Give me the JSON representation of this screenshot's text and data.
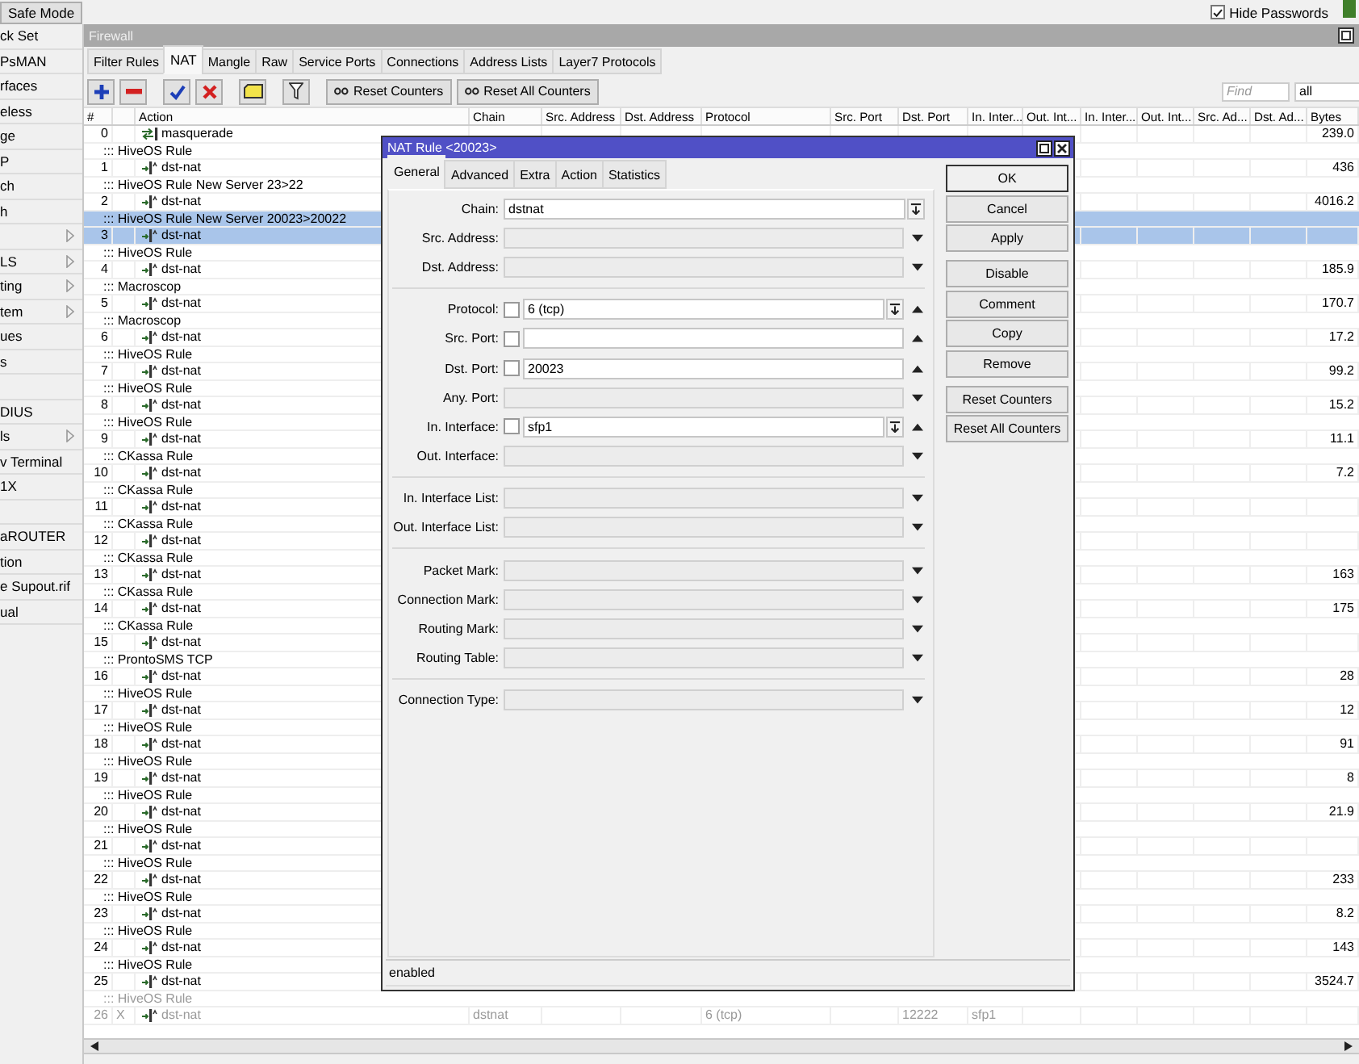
{
  "top_bar": {
    "safe_mode": "Safe Mode",
    "hide_passwords": {
      "label": "Hide Passwords",
      "checked": true
    }
  },
  "sidebar": {
    "items": [
      {
        "label": "ck Set",
        "submenu": false
      },
      {
        "label": "PsMAN",
        "submenu": false
      },
      {
        "label": "rfaces",
        "submenu": false
      },
      {
        "label": "eless",
        "submenu": false
      },
      {
        "label": "ge",
        "submenu": false
      },
      {
        "label": "P",
        "submenu": false
      },
      {
        "label": "ch",
        "submenu": false
      },
      {
        "label": "h",
        "submenu": false
      },
      {
        "submenu": true
      },
      {
        "label": "LS",
        "submenu": true
      },
      {
        "label": "ting",
        "submenu": true
      },
      {
        "label": "tem",
        "submenu": true
      },
      {
        "label": "ues",
        "submenu": false
      },
      {
        "label": "s",
        "submenu": false
      },
      {
        "submenu": false
      },
      {
        "label": "DIUS",
        "submenu": false
      },
      {
        "label": "ls",
        "submenu": true
      },
      {
        "label": "v Terminal",
        "submenu": false
      },
      {
        "label": "1X",
        "submenu": false
      },
      {
        "submenu": false
      },
      {
        "label": "aROUTER",
        "submenu": false
      },
      {
        "label": "tion",
        "submenu": false
      },
      {
        "label": "e Supout.rif",
        "submenu": false
      },
      {
        "label": "ual",
        "submenu": false
      }
    ]
  },
  "firewall": {
    "title": "Firewall",
    "tabs": [
      {
        "label": "Filter Rules",
        "selected": false
      },
      {
        "label": "NAT",
        "selected": true
      },
      {
        "label": "Mangle",
        "selected": false
      },
      {
        "label": "Raw",
        "selected": false
      },
      {
        "label": "Service Ports",
        "selected": false
      },
      {
        "label": "Connections",
        "selected": false
      },
      {
        "label": "Address Lists",
        "selected": false
      },
      {
        "label": "Layer7 Protocols",
        "selected": false
      }
    ],
    "toolbar": {
      "icons": [
        {
          "kind": "add"
        },
        {
          "kind": "remove"
        },
        {
          "kind": "enable"
        },
        {
          "kind": "disable"
        },
        {
          "kind": "comment"
        },
        {
          "kind": "filter"
        }
      ],
      "buttons": [
        "Reset Counters",
        "Reset All Counters"
      ],
      "find_placeholder": "Find",
      "filter_value": "all"
    },
    "table": {
      "columns": [
        "#",
        "Action",
        "Chain",
        "Src. Address",
        "Dst. Address",
        "Protocol",
        "Src. Port",
        "Dst. Port",
        "In. Inter...",
        "Out. Int...",
        "In. Inter...",
        "Out. Int...",
        "Src. Ad...",
        "Dst. Ad...",
        "Bytes"
      ],
      "rows": [
        {
          "kind": "masquerade",
          "number": "0",
          "action": "masquerade",
          "bytes": "239.0",
          "selected": false,
          "disabled": false
        },
        {
          "kind": "comment",
          "text": "::: HiveOS Rule",
          "selected": false,
          "disabled": false
        },
        {
          "kind": "dst-nat",
          "number": "1",
          "action": "dst-nat",
          "bytes": "436",
          "selected": false,
          "disabled": false
        },
        {
          "kind": "comment",
          "text": "::: HiveOS Rule New Server 23>22",
          "selected": false,
          "disabled": false
        },
        {
          "kind": "dst-nat",
          "number": "2",
          "action": "dst-nat",
          "bytes": "4016.2",
          "selected": false,
          "disabled": false
        },
        {
          "kind": "comment",
          "text": "::: HiveOS Rule New Server 20023>20022",
          "selected": true,
          "disabled": false
        },
        {
          "kind": "dst-nat",
          "number": "3",
          "action": "dst-nat",
          "selected": true,
          "disabled": false
        },
        {
          "kind": "comment",
          "text": "::: HiveOS Rule",
          "selected": false,
          "disabled": false
        },
        {
          "kind": "dst-nat",
          "number": "4",
          "action": "dst-nat",
          "bytes": "185.9",
          "selected": false,
          "disabled": false
        },
        {
          "kind": "comment",
          "text": "::: Macroscop",
          "selected": false,
          "disabled": false
        },
        {
          "kind": "dst-nat",
          "number": "5",
          "action": "dst-nat",
          "bytes": "170.7",
          "selected": false,
          "disabled": false
        },
        {
          "kind": "comment",
          "text": "::: Macroscop",
          "selected": false,
          "disabled": false
        },
        {
          "kind": "dst-nat",
          "number": "6",
          "action": "dst-nat",
          "bytes": "17.2",
          "selected": false,
          "disabled": false
        },
        {
          "kind": "comment",
          "text": "::: HiveOS Rule",
          "selected": false,
          "disabled": false
        },
        {
          "kind": "dst-nat",
          "number": "7",
          "action": "dst-nat",
          "bytes": "99.2",
          "selected": false,
          "disabled": false
        },
        {
          "kind": "comment",
          "text": "::: HiveOS Rule",
          "selected": false,
          "disabled": false
        },
        {
          "kind": "dst-nat",
          "number": "8",
          "action": "dst-nat",
          "bytes": "15.2",
          "selected": false,
          "disabled": false
        },
        {
          "kind": "comment",
          "text": "::: HiveOS Rule",
          "selected": false,
          "disabled": false
        },
        {
          "kind": "dst-nat",
          "number": "9",
          "action": "dst-nat",
          "bytes": "11.1",
          "selected": false,
          "disabled": false
        },
        {
          "kind": "comment",
          "text": "::: CKassa Rule",
          "selected": false,
          "disabled": false
        },
        {
          "kind": "dst-nat",
          "number": "10",
          "action": "dst-nat",
          "bytes": "7.2",
          "selected": false,
          "disabled": false
        },
        {
          "kind": "comment",
          "text": "::: CKassa Rule",
          "selected": false,
          "disabled": false
        },
        {
          "kind": "dst-nat",
          "number": "11",
          "action": "dst-nat",
          "selected": false,
          "disabled": false
        },
        {
          "kind": "comment",
          "text": "::: CKassa Rule",
          "selected": false,
          "disabled": false
        },
        {
          "kind": "dst-nat",
          "number": "12",
          "action": "dst-nat",
          "selected": false,
          "disabled": false
        },
        {
          "kind": "comment",
          "text": "::: CKassa Rule",
          "selected": false,
          "disabled": false
        },
        {
          "kind": "dst-nat",
          "number": "13",
          "action": "dst-nat",
          "bytes": "163",
          "selected": false,
          "disabled": false
        },
        {
          "kind": "comment",
          "text": "::: CKassa Rule",
          "selected": false,
          "disabled": false
        },
        {
          "kind": "dst-nat",
          "number": "14",
          "action": "dst-nat",
          "bytes": "175",
          "selected": false,
          "disabled": false
        },
        {
          "kind": "comment",
          "text": "::: CKassa Rule",
          "selected": false,
          "disabled": false
        },
        {
          "kind": "dst-nat",
          "number": "15",
          "action": "dst-nat",
          "selected": false,
          "disabled": false
        },
        {
          "kind": "comment",
          "text": "::: ProntoSMS TCP",
          "selected": false,
          "disabled": false
        },
        {
          "kind": "dst-nat",
          "number": "16",
          "action": "dst-nat",
          "bytes": "28",
          "selected": false,
          "disabled": false
        },
        {
          "kind": "comment",
          "text": "::: HiveOS Rule",
          "selected": false,
          "disabled": false
        },
        {
          "kind": "dst-nat",
          "number": "17",
          "action": "dst-nat",
          "bytes": "12",
          "selected": false,
          "disabled": false
        },
        {
          "kind": "comment",
          "text": "::: HiveOS Rule",
          "selected": false,
          "disabled": false
        },
        {
          "kind": "dst-nat",
          "number": "18",
          "action": "dst-nat",
          "bytes": "91",
          "selected": false,
          "disabled": false
        },
        {
          "kind": "comment",
          "text": "::: HiveOS Rule",
          "selected": false,
          "disabled": false
        },
        {
          "kind": "dst-nat",
          "number": "19",
          "action": "dst-nat",
          "bytes": "8",
          "selected": false,
          "disabled": false
        },
        {
          "kind": "comment",
          "text": "::: HiveOS Rule",
          "selected": false,
          "disabled": false
        },
        {
          "kind": "dst-nat",
          "number": "20",
          "action": "dst-nat",
          "bytes": "21.9",
          "selected": false,
          "disabled": false
        },
        {
          "kind": "comment",
          "text": "::: HiveOS Rule",
          "selected": false,
          "disabled": false
        },
        {
          "kind": "dst-nat",
          "number": "21",
          "action": "dst-nat",
          "selected": false,
          "disabled": false
        },
        {
          "kind": "comment",
          "text": "::: HiveOS Rule",
          "selected": false,
          "disabled": false
        },
        {
          "kind": "dst-nat",
          "number": "22",
          "action": "dst-nat",
          "bytes": "233",
          "selected": false,
          "disabled": false
        },
        {
          "kind": "comment",
          "text": "::: HiveOS Rule",
          "selected": false,
          "disabled": false
        },
        {
          "kind": "dst-nat",
          "number": "23",
          "action": "dst-nat",
          "bytes": "8.2",
          "selected": false,
          "disabled": false
        },
        {
          "kind": "comment",
          "text": "::: HiveOS Rule",
          "selected": false,
          "disabled": false
        },
        {
          "kind": "dst-nat",
          "number": "24",
          "action": "dst-nat",
          "bytes": "143",
          "selected": false,
          "disabled": false
        },
        {
          "kind": "comment",
          "text": "::: HiveOS Rule",
          "selected": false,
          "disabled": false
        },
        {
          "kind": "dst-nat",
          "number": "25",
          "action": "dst-nat",
          "bytes": "3524.7",
          "selected": false,
          "disabled": false
        },
        {
          "kind": "comment",
          "text": "::: HiveOS Rule",
          "selected": false,
          "disabled": true
        },
        {
          "kind": "dst-nat",
          "number": "26",
          "flag": "X",
          "action": "dst-nat",
          "chain": "dstnat",
          "protocol": "6 (tcp)",
          "dst_port": "12222",
          "in_interface": "sfp1",
          "selected": false,
          "disabled": true
        }
      ]
    }
  },
  "dialog": {
    "title": "NAT Rule <20023>",
    "tabs": [
      {
        "label": "General",
        "selected": true
      },
      {
        "label": "Advanced",
        "selected": false
      },
      {
        "label": "Extra",
        "selected": false
      },
      {
        "label": "Action",
        "selected": false
      },
      {
        "label": "Statistics",
        "selected": false
      }
    ],
    "sections": [
      {
        "fields": [
          {
            "label": "Chain:",
            "value": "dstnat",
            "kind": "combo"
          },
          {
            "label": "Src. Address:",
            "kind": "unset",
            "expanded": false
          },
          {
            "label": "Dst. Address:",
            "kind": "unset",
            "expanded": false
          }
        ]
      },
      {
        "fields": [
          {
            "label": "Protocol:",
            "value": "6 (tcp)",
            "kind": "combo",
            "negate": false,
            "expanded": true
          },
          {
            "label": "Src. Port:",
            "kind": "input",
            "negate": false,
            "expanded": true
          },
          {
            "label": "Dst. Port:",
            "value": "20023",
            "kind": "input",
            "negate": false,
            "expanded": true
          },
          {
            "label": "Any. Port:",
            "kind": "unset",
            "expanded": false
          },
          {
            "label": "In. Interface:",
            "value": "sfp1",
            "kind": "combo",
            "negate": false,
            "expanded": true
          },
          {
            "label": "Out. Interface:",
            "kind": "unset",
            "expanded": false
          }
        ]
      },
      {
        "fields": [
          {
            "label": "In. Interface List:",
            "kind": "unset",
            "expanded": false
          },
          {
            "label": "Out. Interface List:",
            "kind": "unset",
            "expanded": false
          }
        ]
      },
      {
        "fields": [
          {
            "label": "Packet Mark:",
            "kind": "unset",
            "expanded": false
          },
          {
            "label": "Connection Mark:",
            "kind": "unset",
            "expanded": false
          },
          {
            "label": "Routing Mark:",
            "kind": "unset",
            "expanded": false
          },
          {
            "label": "Routing Table:",
            "kind": "unset",
            "expanded": false
          }
        ]
      },
      {
        "fields": [
          {
            "label": "Connection Type:",
            "kind": "unset",
            "expanded": false
          }
        ]
      }
    ],
    "button_groups": [
      [
        {
          "label": "OK",
          "default": true
        },
        {
          "label": "Cancel",
          "default": false
        },
        {
          "label": "Apply",
          "default": false
        }
      ],
      [
        {
          "label": "Disable",
          "default": false
        },
        {
          "label": "Comment",
          "default": false
        },
        {
          "label": "Copy",
          "default": false
        },
        {
          "label": "Remove",
          "default": false
        }
      ],
      [
        {
          "label": "Reset Counters",
          "default": false
        },
        {
          "label": "Reset All Counters",
          "default": false
        }
      ]
    ],
    "status": "enabled"
  }
}
